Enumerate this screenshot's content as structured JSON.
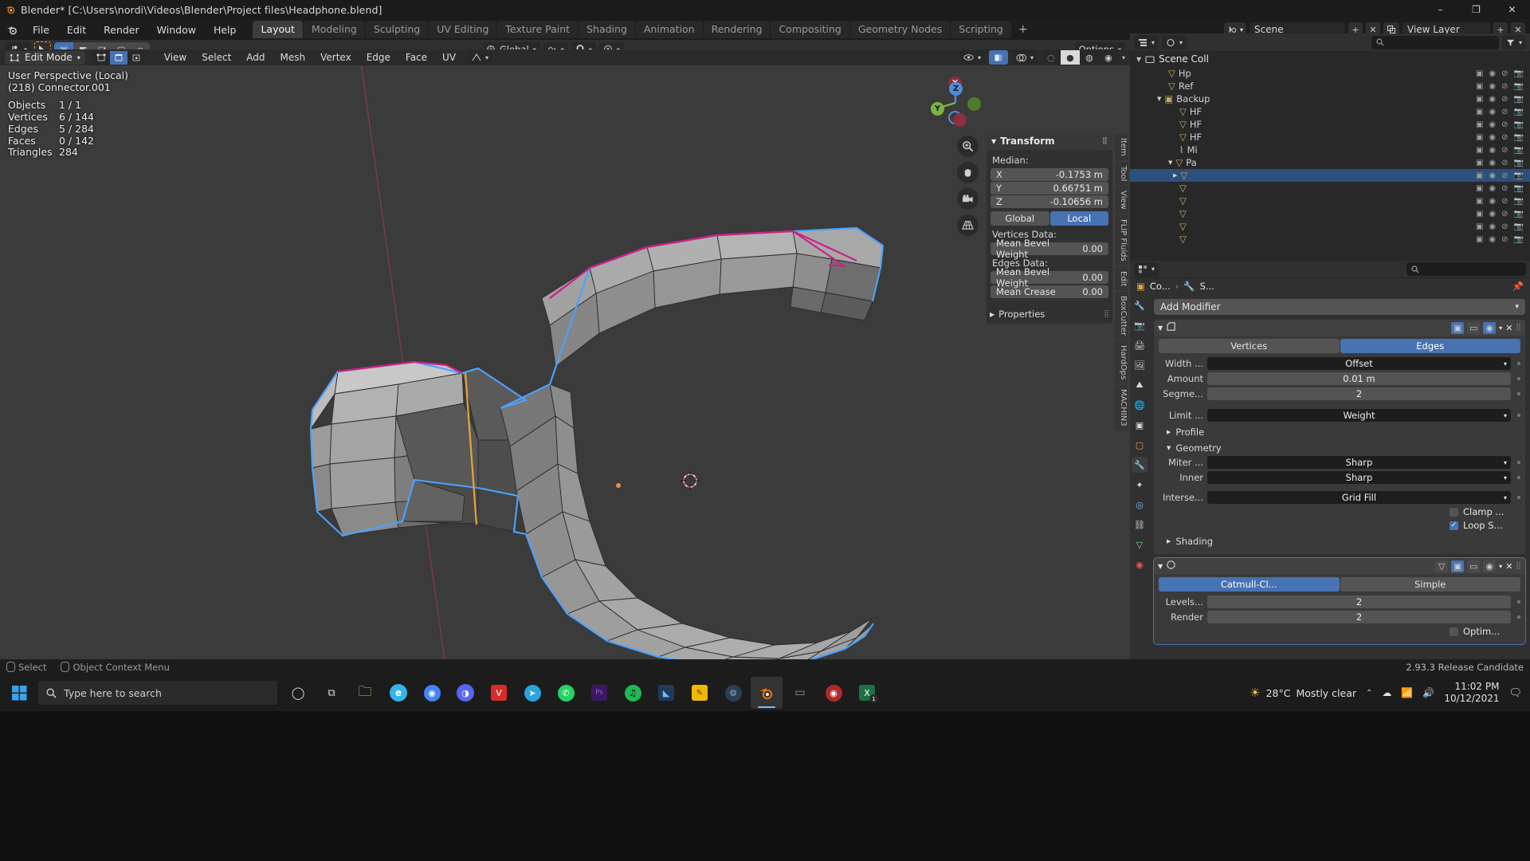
{
  "window": {
    "app_name": "Blender*",
    "title": "Blender* [C:\\Users\\nordi\\Videos\\Blender\\Project files\\Headphone.blend]",
    "minimize": "–",
    "maximize": "❐",
    "close": "✕"
  },
  "topbar": {
    "menus": [
      "File",
      "Edit",
      "Render",
      "Window",
      "Help"
    ],
    "workspaces": [
      {
        "label": "Layout",
        "active": true
      },
      {
        "label": "Modeling",
        "active": false
      },
      {
        "label": "Sculpting",
        "active": false
      },
      {
        "label": "UV Editing",
        "active": false
      },
      {
        "label": "Texture Paint",
        "active": false
      },
      {
        "label": "Shading",
        "active": false
      },
      {
        "label": "Animation",
        "active": false
      },
      {
        "label": "Rendering",
        "active": false
      },
      {
        "label": "Compositing",
        "active": false
      },
      {
        "label": "Geometry Nodes",
        "active": false
      },
      {
        "label": "Scripting",
        "active": false
      }
    ],
    "add_workspace": "+",
    "scene_label": "Scene",
    "viewlayer_label": "View Layer"
  },
  "tool_header": {
    "transform_orientation": "Global",
    "options_label": "Options",
    "snap_icon": "magnet-icon",
    "proportional_icon": "proportional-edit-icon"
  },
  "mode_header": {
    "mode": "Edit Mode",
    "menus": [
      "View",
      "Select",
      "Add",
      "Mesh",
      "Vertex",
      "Edge",
      "Face",
      "UV"
    ]
  },
  "viewport": {
    "view_name": "User Perspective (Local)",
    "object_name": "(218) Connector.001",
    "stats": [
      {
        "label": "Objects",
        "value": "1 / 1"
      },
      {
        "label": "Vertices",
        "value": "6 / 144"
      },
      {
        "label": "Edges",
        "value": "5 / 284"
      },
      {
        "label": "Faces",
        "value": "0 / 142"
      },
      {
        "label": "Triangles",
        "value": "284"
      }
    ],
    "gizmo_axes": [
      "X",
      "Y",
      "Z"
    ],
    "nav_icons": [
      "zoom-icon",
      "pan-hand-icon",
      "camera-icon",
      "grid-perspective-icon"
    ],
    "colors": {
      "background": "#3b3b3b",
      "selected_edge": "#4aa3ff",
      "crease_edge": "#cc2288",
      "active_edge": "#e8a33d",
      "mesh_face": "#b0b0b0"
    }
  },
  "npanel": {
    "tabs": [
      "Item",
      "Tool",
      "View",
      "FLIP Fluids",
      "Edit",
      "BoxCutter",
      "HardOps",
      "MACHIN3"
    ],
    "title": "Transform",
    "median_label": "Median:",
    "median": [
      {
        "axis": "X",
        "value": "-0.1753 m"
      },
      {
        "axis": "Y",
        "value": "0.66751 m"
      },
      {
        "axis": "Z",
        "value": "-0.10656 m"
      }
    ],
    "space_options": [
      {
        "label": "Global",
        "active": false
      },
      {
        "label": "Local",
        "active": true
      }
    ],
    "vertices_data_label": "Vertices Data:",
    "vertices_data": [
      {
        "label": "Mean Bevel Weight",
        "value": "0.00"
      }
    ],
    "edges_data_label": "Edges Data:",
    "edges_data": [
      {
        "label": "Mean Bevel Weight",
        "value": "0.00"
      },
      {
        "label": "Mean Crease",
        "value": "0.00"
      }
    ],
    "properties_label": "Properties"
  },
  "outliner": {
    "search_placeholder": "",
    "scene_collection": "Scene Coll",
    "rows": [
      {
        "label": "Hp",
        "depth": 2,
        "selected": false
      },
      {
        "label": "Ref",
        "depth": 2,
        "selected": false
      },
      {
        "label": "Backup",
        "depth": 1,
        "selected": false
      },
      {
        "label": "HF",
        "depth": 3,
        "selected": false
      },
      {
        "label": "HF",
        "depth": 3,
        "selected": false
      },
      {
        "label": "HF",
        "depth": 3,
        "selected": false
      },
      {
        "label": "Mi",
        "depth": 3,
        "selected": false
      },
      {
        "label": "Pa",
        "depth": 2,
        "selected": false
      },
      {
        "label": "",
        "depth": 3,
        "selected": true
      },
      {
        "label": "",
        "depth": 3,
        "selected": false
      },
      {
        "label": "",
        "depth": 3,
        "selected": false
      },
      {
        "label": "",
        "depth": 3,
        "selected": false
      },
      {
        "label": "",
        "depth": 3,
        "selected": false
      },
      {
        "label": "",
        "depth": 3,
        "selected": false
      }
    ]
  },
  "properties": {
    "breadcrumb": [
      {
        "label": "Co...",
        "icon": "object-icon"
      },
      {
        "label": "S...",
        "icon": "modifier-icon"
      }
    ],
    "add_modifier": "Add Modifier",
    "modifiers": [
      {
        "name": "bevel-modifier",
        "affect": [
          {
            "label": "Vertices",
            "active": false
          },
          {
            "label": "Edges",
            "active": true
          }
        ],
        "rows": [
          {
            "label": "Width ...",
            "value": "Offset",
            "type": "dropdown"
          },
          {
            "label": "Amount",
            "value": "0.01 m",
            "type": "number"
          },
          {
            "label": "Segme...",
            "value": "2",
            "type": "number"
          },
          {
            "label": "Limit ...",
            "value": "Weight",
            "type": "dropdown"
          }
        ],
        "sections": [
          {
            "label": "Profile",
            "open": false
          },
          {
            "label": "Geometry",
            "open": true
          }
        ],
        "geometry_rows": [
          {
            "label": "Miter ...",
            "value": "Sharp",
            "type": "dropdown"
          },
          {
            "label": "Inner",
            "value": "Sharp",
            "type": "dropdown"
          },
          {
            "label": "Interse...",
            "value": "Grid Fill",
            "type": "dropdown"
          }
        ],
        "checks": [
          {
            "label": "Clamp ...",
            "checked": false
          },
          {
            "label": "Loop S...",
            "checked": true
          }
        ],
        "shading": {
          "label": "Shading",
          "open": false
        }
      },
      {
        "name": "subdivision-modifier",
        "algorithm": [
          {
            "label": "Catmull-Cl...",
            "active": true
          },
          {
            "label": "Simple",
            "active": false
          }
        ],
        "rows": [
          {
            "label": "Levels...",
            "value": "2"
          },
          {
            "label": "Render",
            "value": "2"
          }
        ],
        "checks": [
          {
            "label": "Optim...",
            "checked": false
          }
        ]
      }
    ]
  },
  "statusbar": {
    "hints": [
      "Select",
      "Object Context Menu"
    ],
    "version": "2.93.3 Release Candidate"
  },
  "taskbar": {
    "search_placeholder": "Type here to search",
    "weather_temp": "28°C",
    "weather_desc": "Mostly clear",
    "time": "11:02 PM",
    "date": "10/12/2021",
    "apps": [
      {
        "name": "task-view",
        "glyph": "▣",
        "color": "#dddddd",
        "active": false
      },
      {
        "name": "file-explorer",
        "glyph": "🗀",
        "color": "#f5c242",
        "active": false
      },
      {
        "name": "microsoft-edge",
        "glyph": "e",
        "color": "#35b3e8",
        "active": false
      },
      {
        "name": "google-chrome",
        "glyph": "●",
        "color": "#4285f4",
        "active": false
      },
      {
        "name": "discord",
        "glyph": "◑",
        "color": "#5865f2",
        "active": false
      },
      {
        "name": "vegas-pro",
        "glyph": "V",
        "color": "#d92b2b",
        "active": false
      },
      {
        "name": "telegram",
        "glyph": "➤",
        "color": "#29a4dd",
        "active": false
      },
      {
        "name": "whatsapp",
        "glyph": "✆",
        "color": "#25d366",
        "active": false
      },
      {
        "name": "photoshop",
        "glyph": "Ps",
        "color": "#9b59d0",
        "active": false
      },
      {
        "name": "spotify",
        "glyph": "♫",
        "color": "#1db954",
        "active": false
      },
      {
        "name": "substance",
        "glyph": "◤",
        "color": "#3a7bd5",
        "active": false
      },
      {
        "name": "sticky-notes",
        "glyph": "✎",
        "color": "#f2b705",
        "active": false
      },
      {
        "name": "steam",
        "glyph": "⚙",
        "color": "#4a6b8a",
        "active": false
      },
      {
        "name": "blender",
        "glyph": "◔",
        "color": "#ea7600",
        "active": true
      },
      {
        "name": "explorer-window",
        "glyph": "▭",
        "color": "#9a9a9a",
        "active": false
      },
      {
        "name": "obs-studio",
        "glyph": "◉",
        "color": "#b02a2a",
        "active": false
      },
      {
        "name": "excel",
        "glyph": "X",
        "color": "#1d7044",
        "active": false
      }
    ]
  }
}
